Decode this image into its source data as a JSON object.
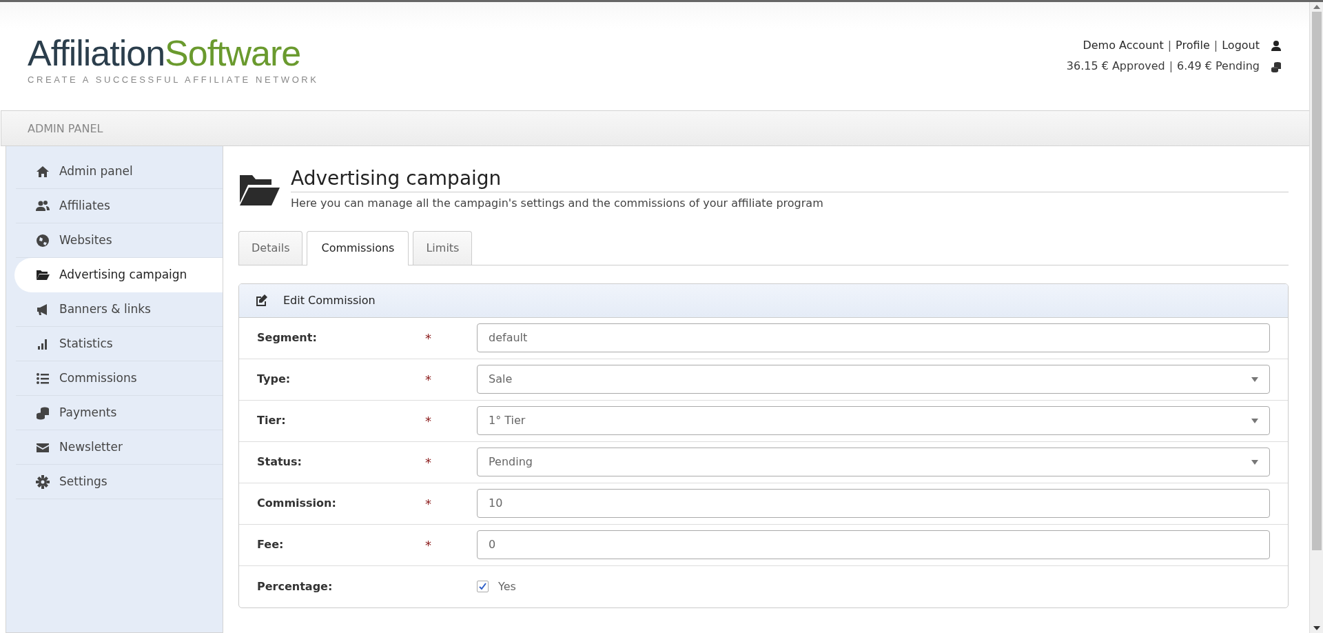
{
  "logo": {
    "part_1": "Affiliation",
    "part_2": "Software",
    "tagline": "CREATE A SUCCESSFUL AFFILIATE NETWORK"
  },
  "account": {
    "links": [
      {
        "kind": "link",
        "text": "Demo Account"
      },
      {
        "kind": "separator",
        "text": "|"
      },
      {
        "kind": "link",
        "text": "Profile"
      },
      {
        "kind": "separator",
        "text": "|"
      },
      {
        "kind": "link",
        "text": "Logout"
      }
    ],
    "balance": [
      {
        "kind": "text",
        "text": "36.15 € Approved"
      },
      {
        "kind": "separator",
        "text": "|"
      },
      {
        "kind": "text",
        "text": "6.49 € Pending"
      }
    ]
  },
  "panel_title": "ADMIN PANEL",
  "sidebar": {
    "items": [
      {
        "label": "Admin panel",
        "selected": false
      },
      {
        "label": "Affiliates",
        "selected": false
      },
      {
        "label": "Websites",
        "selected": false
      },
      {
        "label": "Advertising campaign",
        "selected": true
      },
      {
        "label": "Banners & links",
        "selected": false
      },
      {
        "label": "Statistics",
        "selected": false
      },
      {
        "label": "Commissions",
        "selected": false
      },
      {
        "label": "Payments",
        "selected": false
      },
      {
        "label": "Newsletter",
        "selected": false
      },
      {
        "label": "Settings",
        "selected": false
      }
    ]
  },
  "page": {
    "title": "Advertising campaign",
    "subtitle": "Here you can manage all the campagin's settings and the commissions of your affiliate program"
  },
  "tabs": [
    {
      "label": "Details",
      "selected": false
    },
    {
      "label": "Commissions",
      "selected": true
    },
    {
      "label": "Limits",
      "selected": false
    }
  ],
  "form": {
    "title": "Edit Commission",
    "fields": [
      {
        "kind": "text",
        "label": "Segment:",
        "required_mark": "*",
        "value": "default"
      },
      {
        "kind": "select",
        "label": "Type:",
        "required_mark": "*",
        "value": "Sale"
      },
      {
        "kind": "select",
        "label": "Tier:",
        "required_mark": "*",
        "value": "1° Tier"
      },
      {
        "kind": "select",
        "label": "Status:",
        "required_mark": "*",
        "value": "Pending"
      },
      {
        "kind": "text",
        "label": "Commission:",
        "required_mark": "*",
        "value": "10"
      },
      {
        "kind": "text",
        "label": "Fee:",
        "required_mark": "*",
        "value": "0"
      },
      {
        "kind": "checkbox",
        "label": "Percentage:",
        "checked": true,
        "option": "Yes"
      }
    ]
  }
}
